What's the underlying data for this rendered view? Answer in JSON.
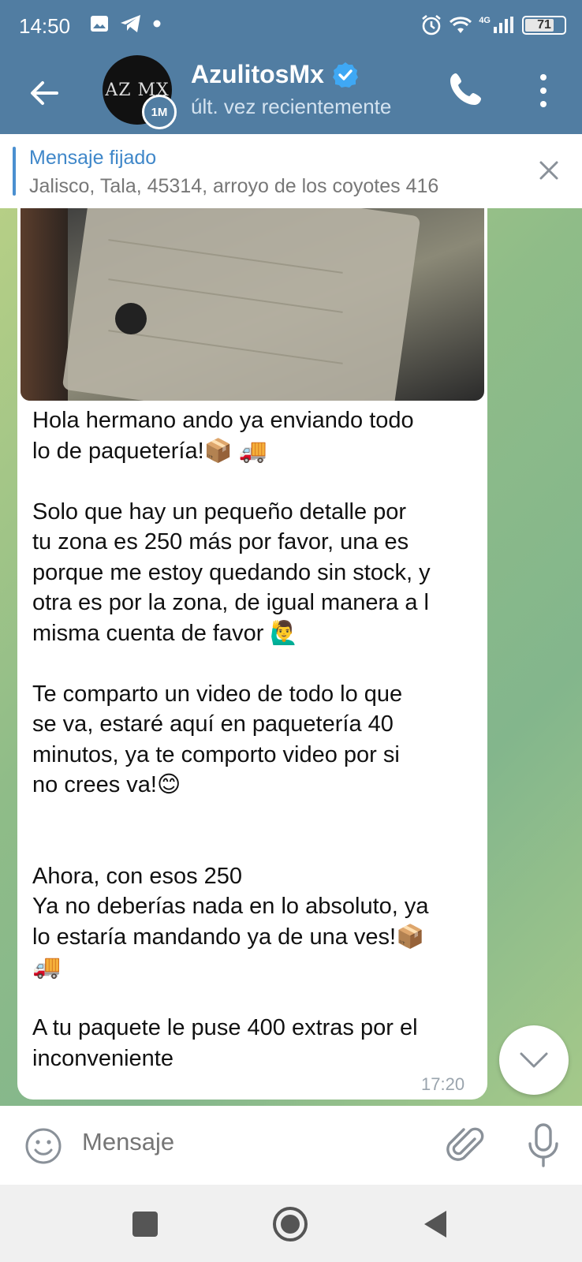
{
  "status_bar": {
    "time": "14:50",
    "network": "4G",
    "battery": "71",
    "icons": [
      "gallery-icon",
      "telegram-icon",
      "dot-icon",
      "alarm-icon",
      "wifi-icon",
      "signal-icon",
      "battery-icon"
    ]
  },
  "header": {
    "name": "AzulitosMx",
    "status": "últ. vez recientemente",
    "avatar_text": "AZ MX",
    "timer_badge": "1M",
    "verified": true,
    "accent_color": "#517da2"
  },
  "pinned": {
    "title": "Mensaje fijado",
    "text": "Jalisco, Tala, 45314, arroyo de los coyotes 416"
  },
  "message": {
    "text": "Hola hermano ando ya enviando todo\nlo de paquetería!📦 🚚\n\nSolo que hay un pequeño detalle por\ntu zona es 250 más por favor, una es\nporque me estoy quedando sin stock, y\notra es por la zona, de igual manera a l\nmisma cuenta de favor 🙋‍♂️\n\nTe comparto un video de todo lo que\nse va, estaré aquí en paquetería 40\nminutos, ya te comporto video por si\nno crees va!😊\n\n\nAhora, con esos 250\nYa no deberías nada en lo absoluto, ya\nlo estaría mandando ya de una ves!📦\n🚚\n\nA tu paquete le puse 400 extras por el\ninconveniente",
    "time": "17:20"
  },
  "input": {
    "placeholder": "Mensaje"
  }
}
